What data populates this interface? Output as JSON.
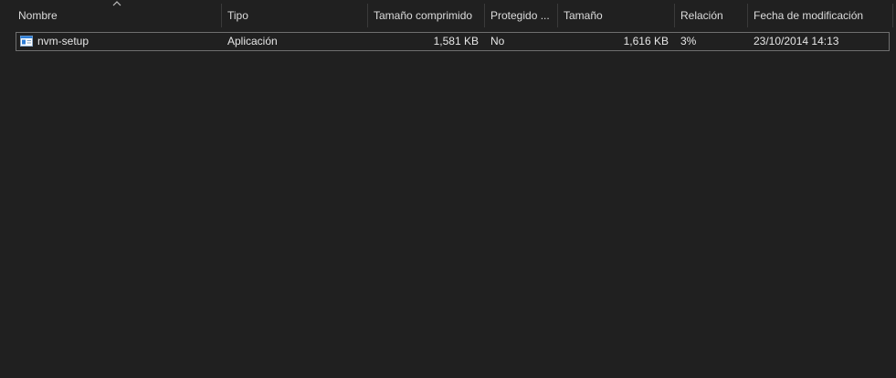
{
  "columns": {
    "name": "Nombre",
    "type": "Tipo",
    "compressed_size": "Tamaño comprimido",
    "protected": "Protegido ...",
    "size": "Tamaño",
    "ratio": "Relación",
    "modified": "Fecha de modificación"
  },
  "files": [
    {
      "icon": "application-icon",
      "name": "nvm-setup",
      "type": "Aplicación",
      "compressed_size": "1,581 KB",
      "protected": "No",
      "size": "1,616 KB",
      "ratio": "3%",
      "modified": "23/10/2014 14:13"
    }
  ],
  "colors": {
    "background": "#202020",
    "text": "#e6e6e6",
    "selection_border": "#6f6f6f",
    "icon_blue": "#2f7fd8"
  },
  "sort": {
    "column": "name",
    "indicator": "sort-ascending-caret"
  }
}
